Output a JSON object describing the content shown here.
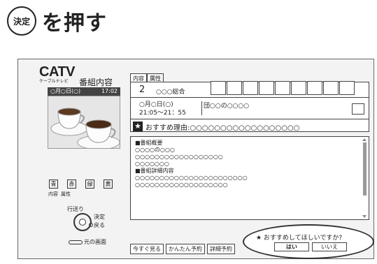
{
  "heading": {
    "badge": "決定",
    "text": "を押す"
  },
  "left": {
    "logo": "CATV",
    "logo_sub": "ケーブルテレビ",
    "title": "番組内容",
    "thumb_date": "○月○日(○)",
    "thumb_time": "17:02",
    "color_keys": [
      "青",
      "赤",
      "緑",
      "黄"
    ],
    "key_labels": [
      "内容",
      "属性"
    ],
    "okuri": "行送り",
    "kettei": "決定",
    "modoru": "戻る",
    "back": "元の画面"
  },
  "tabs": [
    "内容",
    "属性"
  ],
  "channel": {
    "number": "2",
    "name": "○○○総合",
    "date": "○月○日(○)",
    "time": "21:05～21：55",
    "genre": "団○○の○○○○"
  },
  "reason": "おすすめ理由:○○○○○○○○○○○○○○○○○○",
  "detail": {
    "lines": [
      "■番組概要",
      "○○○○の○○○",
      "○○○○○○○○○○○○○○○○○○",
      "○○○○○○○",
      "■番組詳細内容",
      "○○○○○○○○○○○○○○○○○○○○○○○",
      "○○○○○○○○○○○○○○○○○○○"
    ]
  },
  "buttons": [
    "今すぐ見る",
    "かんたん予約",
    "詳細予約"
  ],
  "prompt": {
    "question": "★ おすすめしてほしいですか?",
    "yes": "はい",
    "no": "いいえ"
  }
}
